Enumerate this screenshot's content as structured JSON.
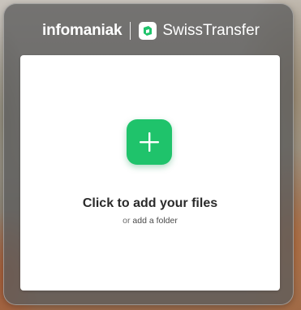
{
  "header": {
    "brand_left": "infomaniak",
    "brand_right": "SwissTransfer",
    "logo_icon": "swisstransfer-logo-icon"
  },
  "dropzone": {
    "add_label": "Click to add your files",
    "or_text": "or",
    "folder_link": "add a folder",
    "add_icon": "plus-icon"
  },
  "colors": {
    "accent": "#1fc36b",
    "card_overlay": "#5c5c5c",
    "dropzone_bg": "#ffffff"
  }
}
